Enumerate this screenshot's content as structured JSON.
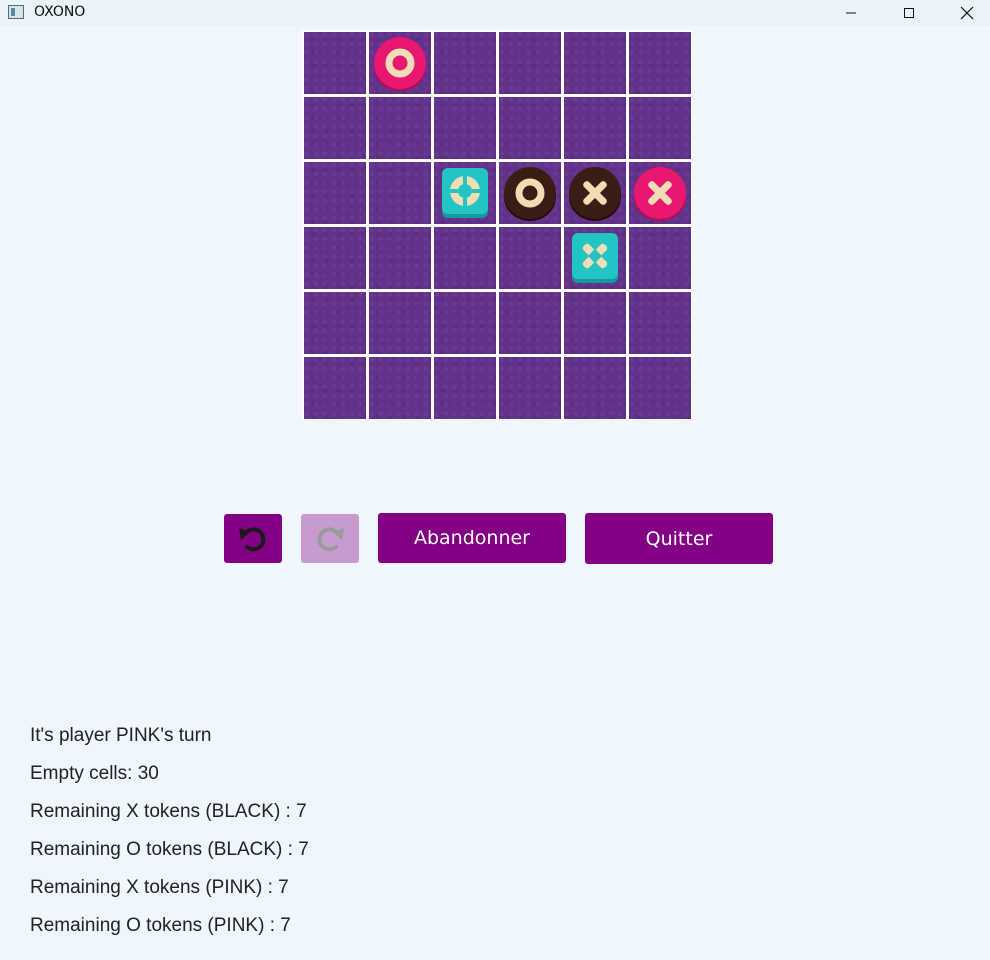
{
  "window": {
    "title": "OXONO",
    "controls": [
      "minimize-icon",
      "maximize-icon",
      "close-icon"
    ]
  },
  "colors": {
    "board_cell": "#62318a",
    "board_grid": "#ffffff",
    "pink": "#e8176f",
    "black": "#3a1e16",
    "totem": "#24c4c4",
    "symbol_cream": "#f1ddb5",
    "button": "#830084",
    "button_disabled": "#c79bd0"
  },
  "board": {
    "rows": 6,
    "cols": 6,
    "pieces": [
      {
        "row": 0,
        "col": 1,
        "kind": "O",
        "owner": "PINK"
      },
      {
        "row": 2,
        "col": 2,
        "kind": "O",
        "owner": "TOTEM"
      },
      {
        "row": 2,
        "col": 3,
        "kind": "O",
        "owner": "BLACK"
      },
      {
        "row": 2,
        "col": 4,
        "kind": "X",
        "owner": "BLACK"
      },
      {
        "row": 2,
        "col": 5,
        "kind": "X",
        "owner": "PINK"
      },
      {
        "row": 3,
        "col": 4,
        "kind": "X",
        "owner": "TOTEM"
      }
    ]
  },
  "controls": {
    "undo_icon": "undo-icon",
    "redo_icon": "redo-icon",
    "redo_enabled": false,
    "abandon_label": "Abandonner",
    "quit_label": "Quitter"
  },
  "status": {
    "turn": "It's player PINK's turn",
    "empty_cells": "Empty cells: 30",
    "x_black": "Remaining X tokens (BLACK) : 7",
    "o_black": "Remaining O tokens (BLACK) : 7",
    "x_pink": "Remaining X tokens (PINK) : 7",
    "o_pink": "Remaining O tokens (PINK) : 7"
  }
}
